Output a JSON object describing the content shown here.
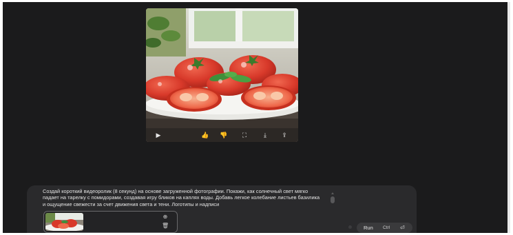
{
  "prompt": {
    "text": "Создай короткий видеоролик (8 секунд) на основе загруженной фотографии. Покажи, как солнечный свет мягко падает на тарелку с помидорами, создавая игру бликов на каплях воды. Добавь легкое колебание листьев базилика и ощущение свежести за счет движения света и тени. Логотипы и надписи"
  },
  "run_button": {
    "label": "Run",
    "shortcut": "Ctrl",
    "shortcut_icon": "⏎"
  },
  "media_toolbar": {
    "icons": [
      "play-icon",
      "thumbs-up-icon",
      "thumbs-down-icon",
      "fullscreen-icon",
      "download-icon",
      "share-icon"
    ]
  },
  "attachment": {
    "icons": [
      "add-file-icon",
      "trash-icon"
    ]
  },
  "colors": {
    "background": "#1b1b1c",
    "panel": "#2a2a2c",
    "tomato": "#d8392a",
    "basil": "#3f8f3a"
  }
}
